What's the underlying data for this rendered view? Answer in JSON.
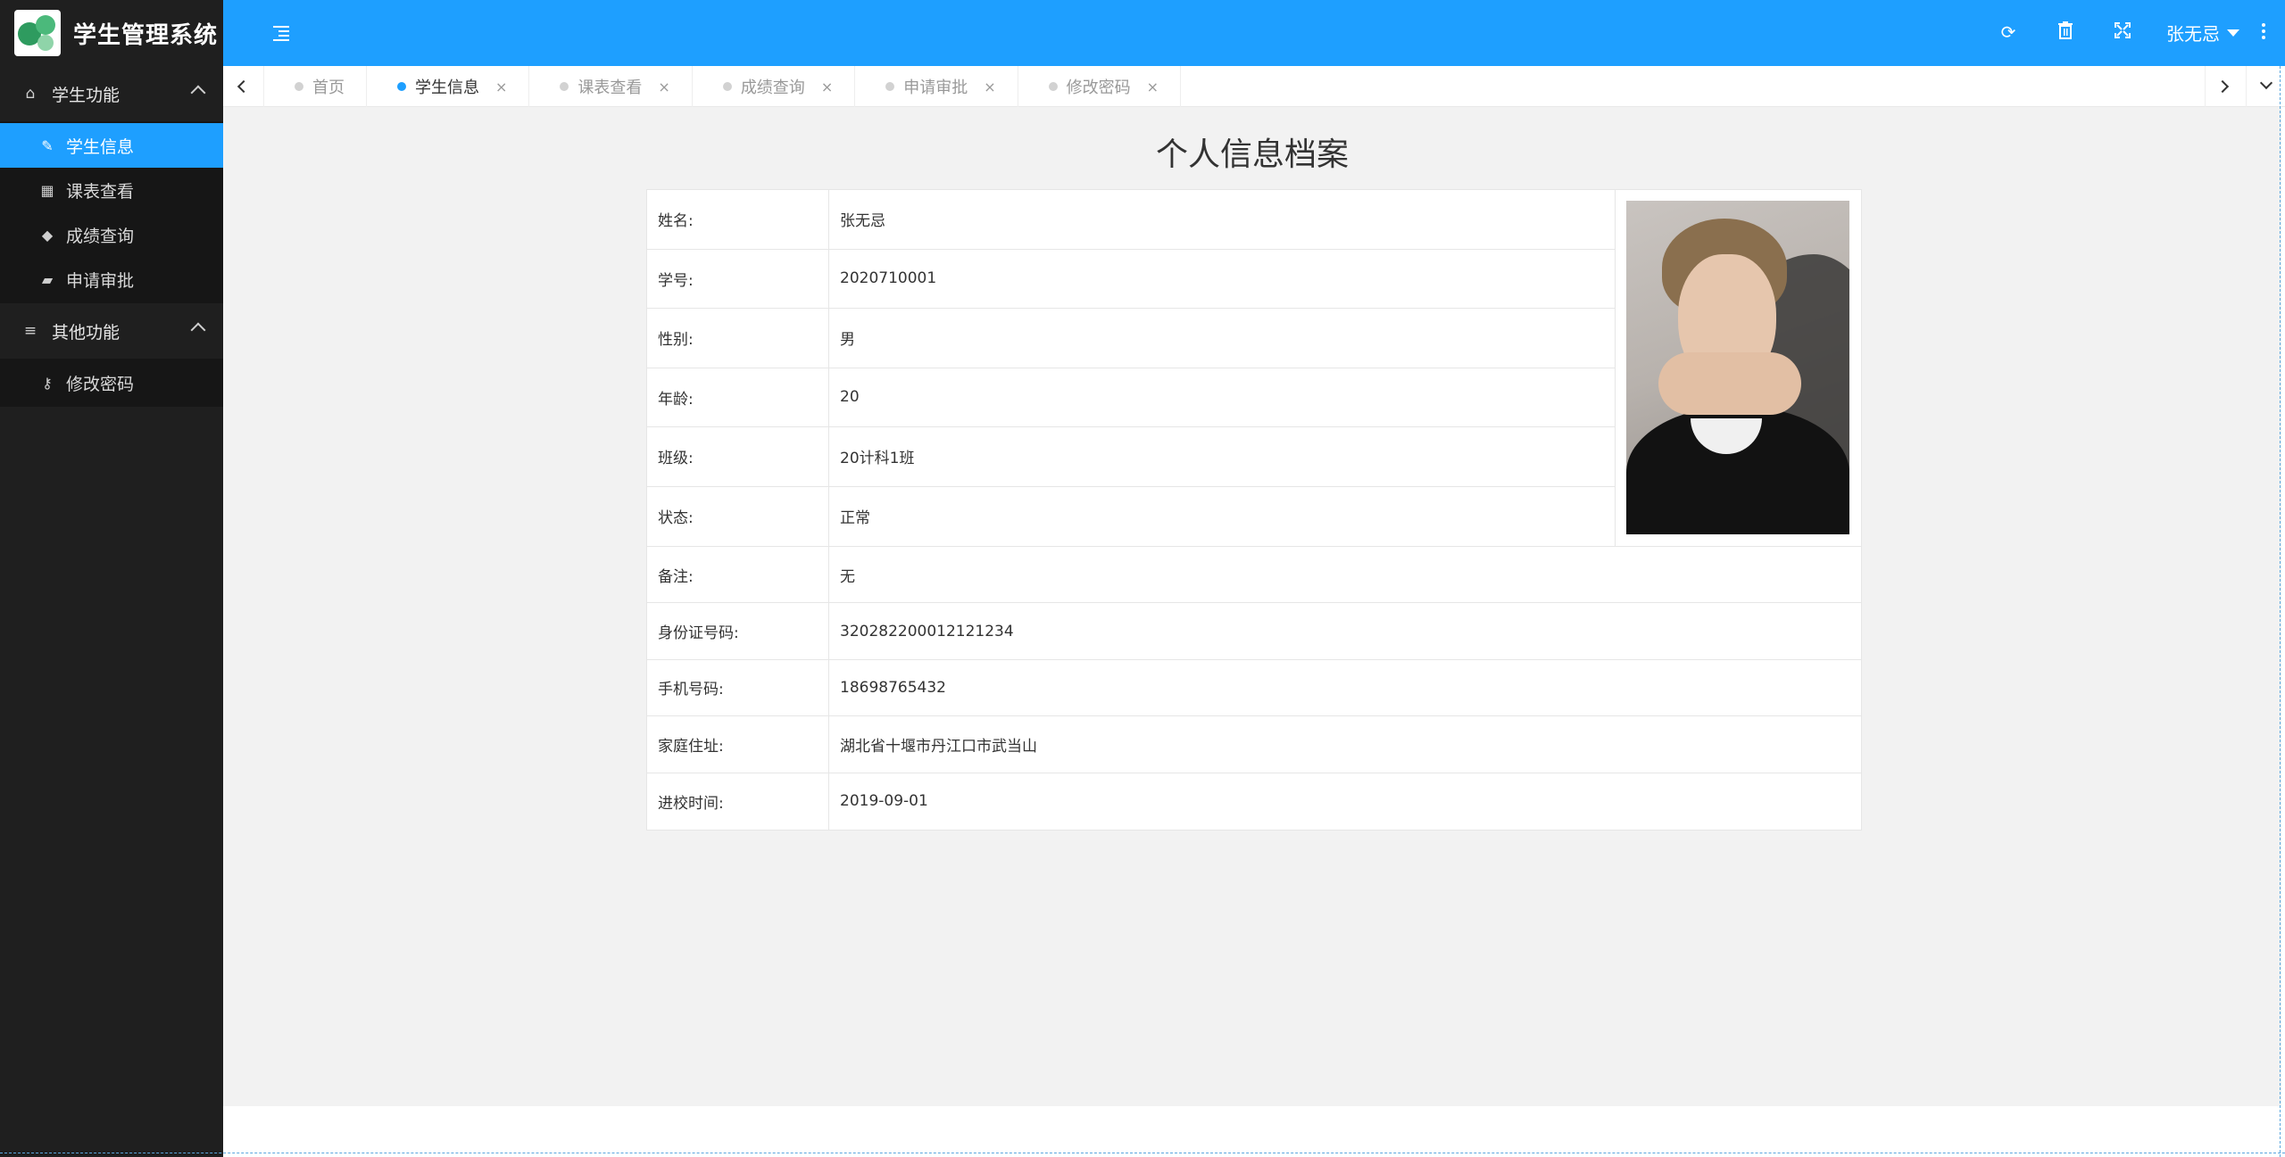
{
  "app": {
    "title": "学生管理系统",
    "user_name": "张无忌"
  },
  "toolbar": {
    "icons": [
      "refresh-icon",
      "trash-icon",
      "fullscreen-icon",
      "more-vertical-icon"
    ]
  },
  "sidebar": {
    "groups": [
      {
        "label": "学生功能",
        "icon": "home-icon",
        "items": [
          {
            "label": "学生信息",
            "icon": "edit-icon",
            "active": true
          },
          {
            "label": "课表查看",
            "icon": "table-icon"
          },
          {
            "label": "成绩查询",
            "icon": "graduation-cap-icon"
          },
          {
            "label": "申请审批",
            "icon": "book-icon"
          }
        ]
      },
      {
        "label": "其他功能",
        "icon": "bars-icon",
        "items": [
          {
            "label": "修改密码",
            "icon": "key-icon"
          }
        ]
      }
    ]
  },
  "tabs": [
    {
      "label": "首页"
    },
    {
      "label": "学生信息",
      "active": true
    },
    {
      "label": "课表查看"
    },
    {
      "label": "成绩查询"
    },
    {
      "label": "申请审批"
    },
    {
      "label": "修改密码"
    }
  ],
  "profile": {
    "title": "个人信息档案",
    "top_rows": [
      {
        "label": "姓名:",
        "value": "张无忌"
      },
      {
        "label": "学号:",
        "value": "2020710001"
      },
      {
        "label": "性别:",
        "value": "男"
      },
      {
        "label": "年龄:",
        "value": "20"
      },
      {
        "label": "班级:",
        "value": "20计科1班"
      },
      {
        "label": "状态:",
        "value": "正常"
      }
    ],
    "bottom_rows": [
      {
        "label": "备注:",
        "value": "无"
      },
      {
        "label": "身份证号码:",
        "value": "320282200012121234"
      },
      {
        "label": "手机号码:",
        "value": "18698765432"
      },
      {
        "label": "家庭住址:",
        "value": "湖北省十堰市丹江口市武当山"
      },
      {
        "label": "进校时间:",
        "value": "2019-09-01"
      }
    ]
  }
}
